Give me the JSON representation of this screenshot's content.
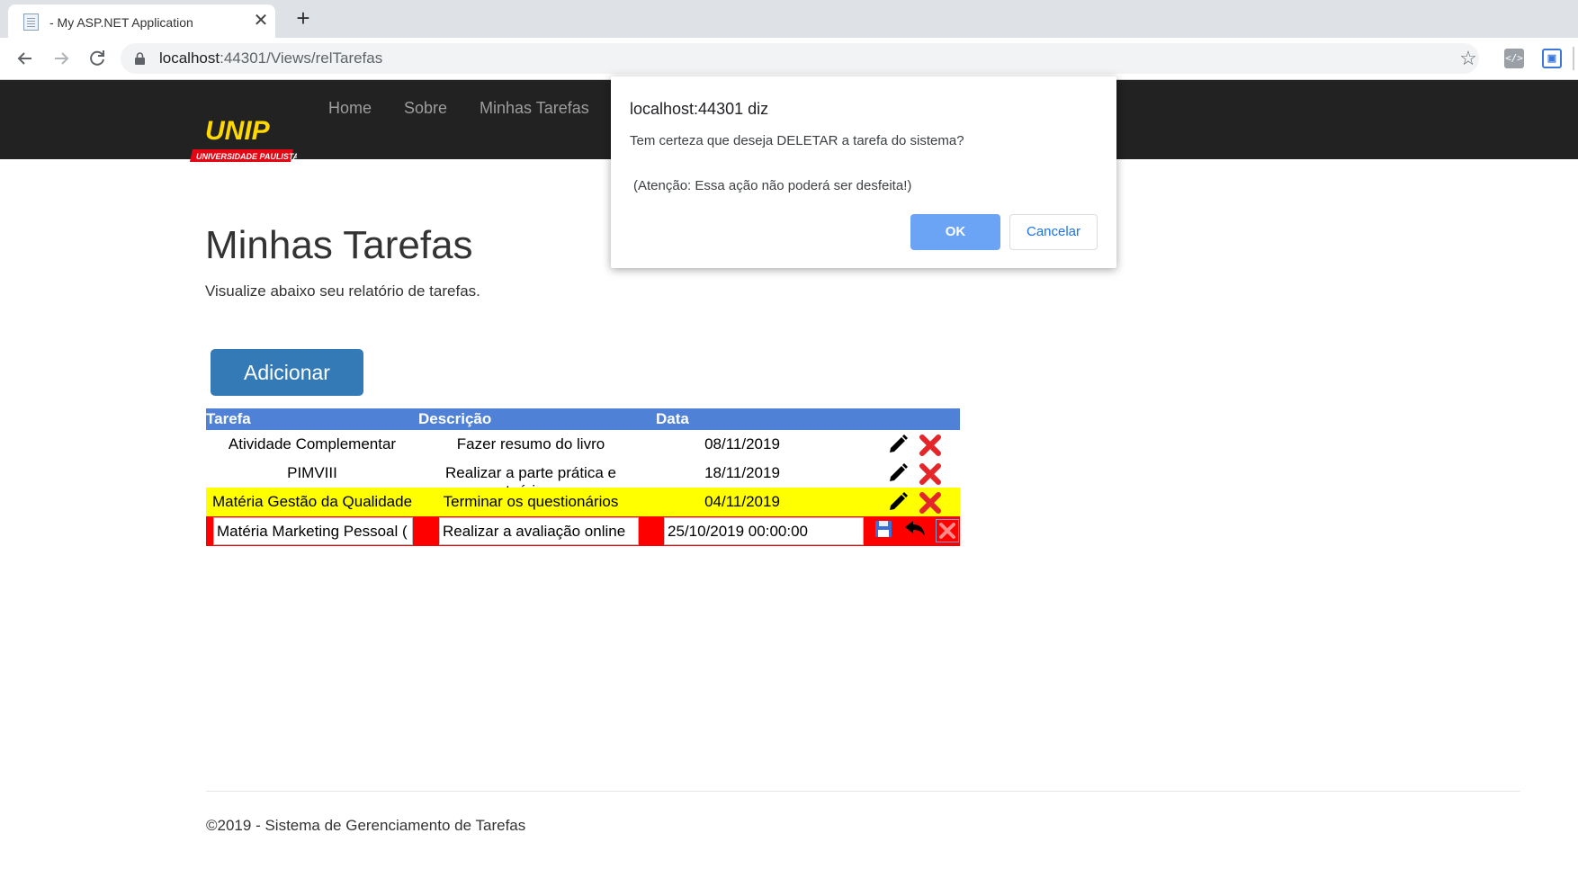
{
  "browser": {
    "tab_title": "- My ASP.NET Application",
    "tab_close": "✕",
    "new_tab": "+",
    "url_host": "localhost",
    "url_rest": ":44301/Views/relTarefas",
    "star": "☆"
  },
  "logo": {
    "text": "UNIP",
    "tagline": "UNIVERSIDADE PAULISTA",
    "color": "#ffd800",
    "band_color": "#e30613"
  },
  "navbar": {
    "links": [
      "Home",
      "Sobre",
      "Minhas Tarefas"
    ]
  },
  "page": {
    "title": "Minhas Tarefas",
    "subtitle": "Visualize abaixo seu relatório de tarefas.",
    "add_label": "Adicionar"
  },
  "table": {
    "headers": [
      "Tarefa",
      "Descrição",
      "Data"
    ],
    "rows": [
      {
        "tarefa": "Atividade Complementar",
        "descricao": "Fazer resumo do livro",
        "data": "08/11/2019"
      },
      {
        "tarefa": "PIMVIII",
        "descricao": "Realizar a parte prática e teórica.",
        "data": "18/11/2019"
      },
      {
        "tarefa": "Matéria Gestão da Qualidade",
        "descricao": "Terminar os questionários",
        "data": "04/11/2019"
      }
    ],
    "edit_row": {
      "tarefa": "Matéria Marketing Pessoal (",
      "descricao": "Realizar a avaliação online",
      "data": "25/10/2019 00:00:00"
    },
    "highlight_color": "#ffff00",
    "edit_row_color": "#ff0000"
  },
  "footer": {
    "text": "©2019 - Sistema de Gerenciamento de Tarefas"
  },
  "dialog": {
    "title": "localhost:44301 diz",
    "message": "Tem certeza que deseja DELETAR a tarefa do sistema?",
    "warning": "(Atenção: Essa ação não poderá ser desfeita!)",
    "ok_label": "OK",
    "cancel_label": "Cancelar"
  }
}
